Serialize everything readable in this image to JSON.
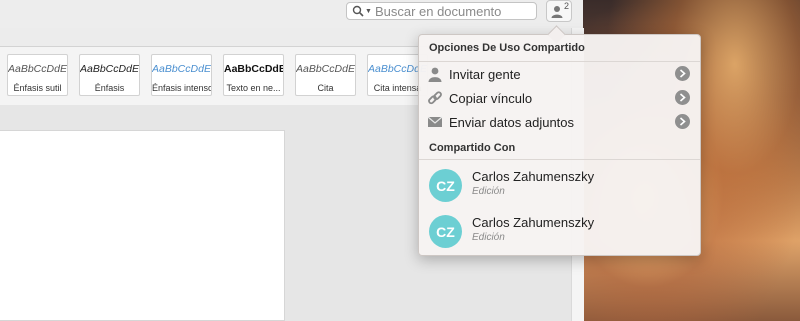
{
  "toolbar": {
    "search_placeholder": "Buscar en documento",
    "share_count": "2"
  },
  "styles": [
    {
      "sample": "AaBbCcDdEe",
      "label": "Énfasis sutil",
      "color": "#555555",
      "weight": "normal",
      "italic": true
    },
    {
      "sample": "AaBbCcDdEe",
      "label": "Énfasis",
      "color": "#222222",
      "weight": "normal",
      "italic": true
    },
    {
      "sample": "AaBbCcDdEe",
      "label": "Énfasis intenso",
      "color": "#4a8fd0",
      "weight": "normal",
      "italic": true
    },
    {
      "sample": "AaBbCcDdEe",
      "label": "Texto en ne...",
      "color": "#111111",
      "weight": "bold",
      "italic": false
    },
    {
      "sample": "AaBbCcDdEe",
      "label": "Cita",
      "color": "#555555",
      "weight": "normal",
      "italic": true
    },
    {
      "sample": "AaBbCcDdEe",
      "label": "Cita intensa",
      "color": "#4a8fd0",
      "weight": "normal",
      "italic": true
    }
  ],
  "share_panel": {
    "title": "Opciones De Uso Compartido",
    "actions": [
      {
        "label": "Invitar gente",
        "icon": "person-icon"
      },
      {
        "label": "Copiar vínculo",
        "icon": "link-icon"
      },
      {
        "label": "Enviar datos adjuntos",
        "icon": "mail-icon"
      }
    ],
    "shared_with_title": "Compartido Con",
    "people": [
      {
        "initials": "CZ",
        "name": "Carlos Zahumenszky",
        "role": "Edición"
      },
      {
        "initials": "CZ",
        "name": "Carlos Zahumenszky",
        "role": "Edición"
      }
    ]
  },
  "colors": {
    "avatar": "#6ccfd3",
    "accent_blue": "#4a8fd0"
  }
}
